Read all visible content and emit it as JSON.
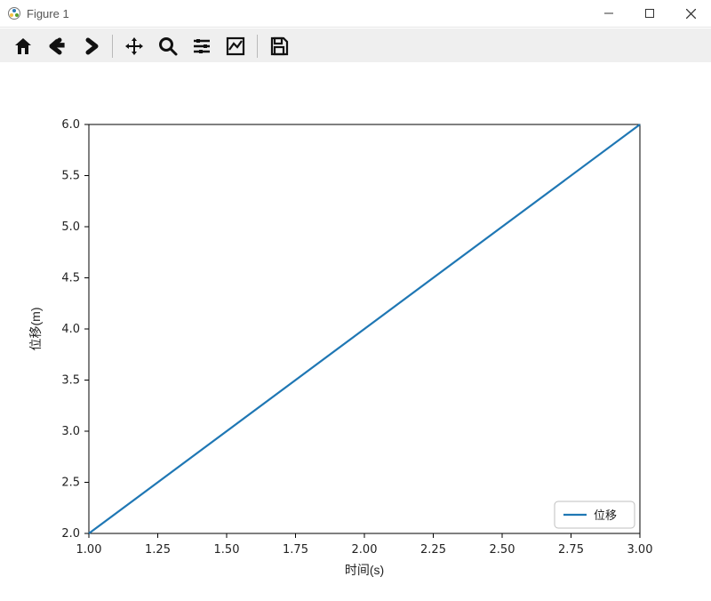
{
  "window": {
    "title": "Figure 1"
  },
  "toolbar": {
    "home": "Home",
    "back": "Back",
    "forward": "Forward",
    "pan": "Pan",
    "zoom": "Zoom",
    "configure": "Configure subplots",
    "edit": "Edit axis",
    "save": "Save"
  },
  "chart_data": {
    "type": "line",
    "x": [
      1.0,
      3.0
    ],
    "series": [
      {
        "name": "位移",
        "values": [
          2.0,
          6.0
        ],
        "color": "#1f77b4"
      }
    ],
    "xlabel": "时间(s)",
    "ylabel": "位移(m)",
    "xlim": [
      1.0,
      3.0
    ],
    "ylim": [
      2.0,
      6.0
    ],
    "xticks": [
      1.0,
      1.25,
      1.5,
      1.75,
      2.0,
      2.25,
      2.5,
      2.75,
      3.0
    ],
    "yticks": [
      2.0,
      2.5,
      3.0,
      3.5,
      4.0,
      4.5,
      5.0,
      5.5,
      6.0
    ],
    "xtick_labels": [
      "1.00",
      "1.25",
      "1.50",
      "1.75",
      "2.00",
      "2.25",
      "2.50",
      "2.75",
      "3.00"
    ],
    "ytick_labels": [
      "2.0",
      "2.5",
      "3.0",
      "3.5",
      "4.0",
      "4.5",
      "5.0",
      "5.5",
      "6.0"
    ],
    "legend_position": "lower right"
  }
}
